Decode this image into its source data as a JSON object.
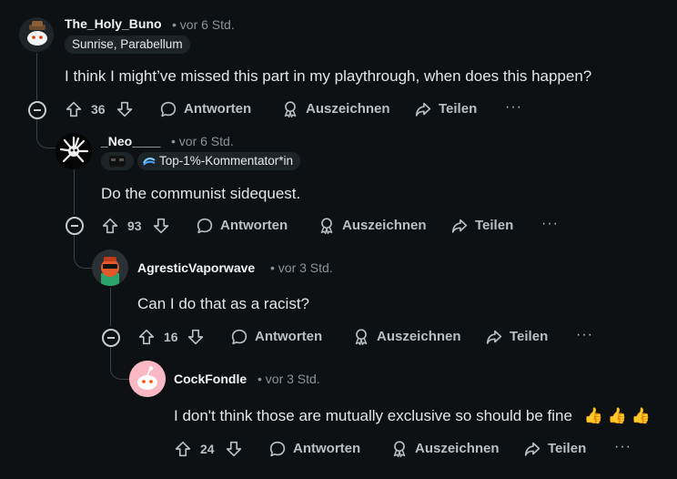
{
  "comments": [
    {
      "username": "The_Holy_Buno",
      "time": "• vor 6 Std.",
      "flair": "Sunrise, Parabellum",
      "text": "I think I might’ve missed this part in my playthrough, when does this happen?",
      "votes": "36"
    },
    {
      "username": "_Neo____",
      "time": "• vor 6 Std.",
      "flair": "Top-1%-Kommentator*in",
      "text": "Do the communist sidequest.",
      "votes": "93"
    },
    {
      "username": "AgresticVaporwave",
      "time": "• vor 3 Std.",
      "text": "Can I do that as a racist?",
      "votes": "16"
    },
    {
      "username": "CockFondle",
      "time": "• vor 3 Std.",
      "text": "I don't think those are mutually exclusive so should be fine",
      "emojis": "👍 👍 👍",
      "votes": "24"
    }
  ],
  "actions": {
    "reply": "Antworten",
    "award": "Auszeichnen",
    "share": "Teilen",
    "more": "···"
  },
  "colors": {
    "background": "#0e1113",
    "text": "#d7dadc",
    "muted": "#8a9499",
    "thread_line": "#3a4247"
  }
}
